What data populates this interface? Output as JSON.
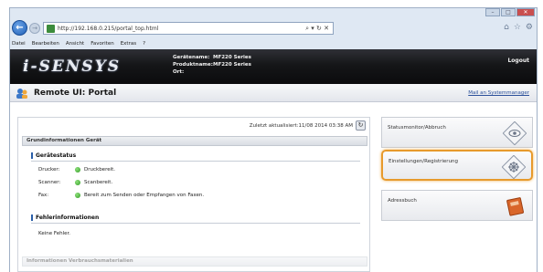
{
  "browser": {
    "url": "http://192.168.0.215/portal_top.html",
    "toolbar_right": "⌕ ▾ ↻ ✕",
    "menu": [
      "Datei",
      "Bearbeiten",
      "Ansicht",
      "Favoriten",
      "Extras",
      "?"
    ]
  },
  "header": {
    "logo": "i-SENSYS",
    "device_name_label": "Gerätename:",
    "device_name": "MF220 Series",
    "product_name_label": "Produktname:",
    "product_name": "MF220 Series",
    "location_label": "Ort:",
    "location": "",
    "logout": "Logout"
  },
  "titlebar": {
    "title": "Remote UI: Portal",
    "mail_link": "Mail an Systemmanager"
  },
  "main": {
    "last_updated": "Zuletzt aktualisiert:11/08 2014 03:38 AM",
    "basic_info_header": "Grundinformationen Gerät",
    "device_status_header": "Gerätestatus",
    "status_rows": [
      {
        "label": "Drucker:",
        "value": "Druckbereit."
      },
      {
        "label": "Scanner:",
        "value": "Scanbereit."
      },
      {
        "label": "Fax:",
        "value": "Bereit zum Senden oder Empfangen von Faxen."
      }
    ],
    "error_info_header": "Fehlerinformationen",
    "error_text": "Keine Fehler.",
    "consumables_header": "Informationen Verbrauchsmaterialien"
  },
  "sidebar": {
    "tiles": [
      {
        "label": "Statusmonitor/Abbruch",
        "icon": "eye-icon"
      },
      {
        "label": "Einstellungen/Registrierung",
        "icon": "settings-icon",
        "highlighted": true
      },
      {
        "label": "Adressbuch",
        "icon": "address-book-icon"
      }
    ]
  },
  "colors": {
    "header_bg": "#151618",
    "highlight": "#e79a2c",
    "status_ok": "#2e9a22",
    "link": "#2a4f9a"
  }
}
